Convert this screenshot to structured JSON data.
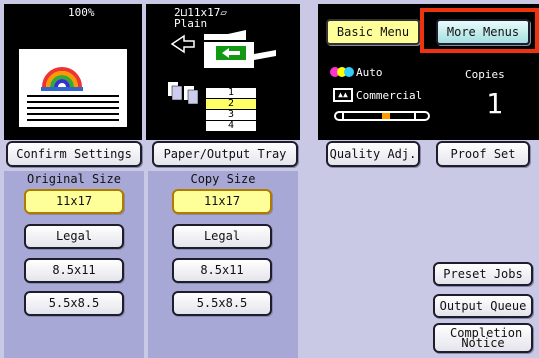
{
  "original_panel": {
    "scale": "100%"
  },
  "output_panel": {
    "duplex_text": "2⊔11x17▱",
    "paper_type": "Plain",
    "tray_numbers": [
      "1",
      "2",
      "3",
      "4"
    ],
    "selected_tray": "2"
  },
  "top_menu": {
    "basic_label": "Basic Menu",
    "more_label": "More Menus"
  },
  "quality_panel": {
    "color_mode": "Auto",
    "image_mode": "Commercial",
    "copies_label": "Copies",
    "copies_value": "1"
  },
  "buttons": {
    "confirm_settings": "Confirm Settings",
    "paper_output_tray": "Paper/Output Tray",
    "quality_adj": "Quality Adj.",
    "proof_set": "Proof Set"
  },
  "original_size": {
    "header": "Original Size",
    "options": [
      "11x17",
      "Legal",
      "8.5x11",
      "5.5x8.5"
    ],
    "selected": "11x17"
  },
  "copy_size": {
    "header": "Copy Size",
    "options": [
      "11x17",
      "Legal",
      "8.5x11",
      "5.5x8.5"
    ],
    "selected": "11x17"
  },
  "job_buttons": {
    "preset_jobs": "Preset Jobs",
    "output_queue": "Output Queue",
    "completion_notice": "Completion Notice"
  },
  "colors": {
    "highlight": "#ee3311",
    "selected": "#ffff9a",
    "background": "#c9c9e6"
  }
}
